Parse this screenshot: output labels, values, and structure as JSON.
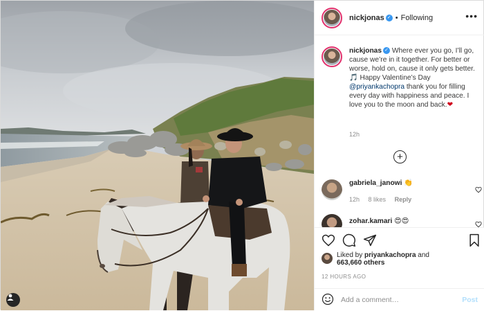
{
  "post": {
    "username": "nickjonas",
    "follow_state": "Following",
    "separator": "•",
    "more": "•••"
  },
  "caption": {
    "username": "nickjonas",
    "text_1": " Where ever you go, I’ll go, cause we’re in it together. For better or worse, hold on, cause it only gets better. ",
    "music_emoji": "🎵",
    "text_2": " Happy Valentine’s Day ",
    "mention": "@priyankachopra",
    "text_3": " thank you for filling every day with happiness and peace. I love you to the moon and back.",
    "heart_emoji": "❤",
    "time": "12h"
  },
  "load_more": "+",
  "comments": [
    {
      "username": "gabriela_janowi",
      "text": "👏",
      "time": "12h",
      "likes": "8 likes",
      "reply": "Reply"
    },
    {
      "username": "zohar.kamari",
      "text": "😍😍",
      "time": "",
      "likes": "",
      "reply": ""
    }
  ],
  "likes": {
    "prefix": "Liked by ",
    "user": "priyankachopra",
    "middle": " and",
    "count": "663,660 others"
  },
  "date": "12 HOURS AGO",
  "add_comment": {
    "placeholder": "Add a comment…",
    "post_label": "Post"
  },
  "colors": {
    "story_ring": "#e1306c",
    "verified": "#3897f0",
    "link": "#00376b",
    "post_disabled": "#b2dffc"
  },
  "icons": [
    "user-tag-icon",
    "verified-icon",
    "heart-icon",
    "comment-icon",
    "share-icon",
    "bookmark-icon",
    "emoji-icon",
    "plus-circle-icon"
  ]
}
